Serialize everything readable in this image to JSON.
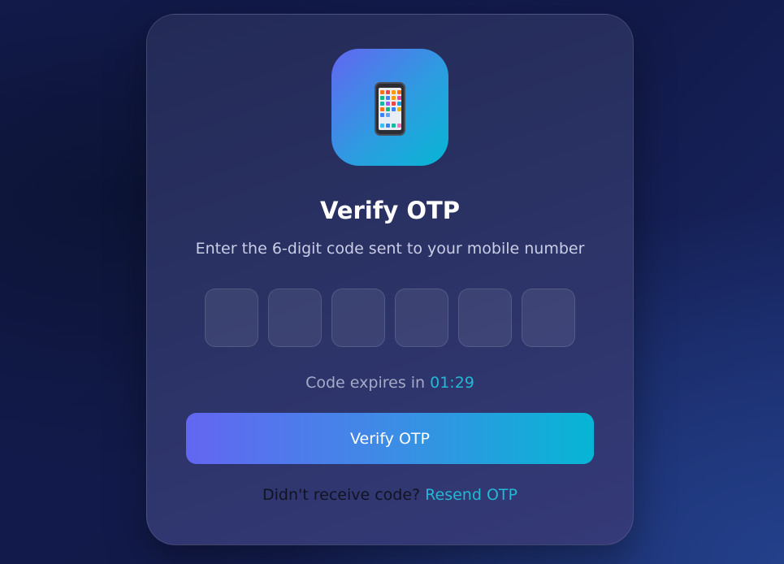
{
  "app_icon": {
    "icon": "mobile-phone-icon"
  },
  "title": "Verify OTP",
  "subtitle": "Enter the 6-digit code sent to your mobile number",
  "otp": {
    "digits": [
      "",
      "",
      "",
      "",
      "",
      ""
    ]
  },
  "timer": {
    "label": "Code expires in",
    "time": "01:29"
  },
  "verify_button": {
    "label": "Verify OTP"
  },
  "resend": {
    "prompt": "Didn't receive code?",
    "link": "Resend OTP"
  },
  "colors": {
    "accent": "#22b8d6",
    "gradient_start": "#6366f1",
    "gradient_end": "#06b6d4",
    "background": "#141c52"
  }
}
